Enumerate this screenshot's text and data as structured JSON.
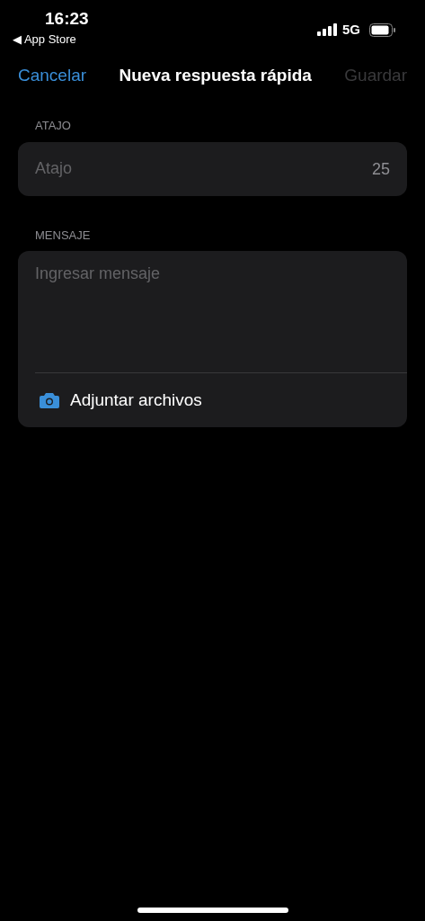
{
  "status_bar": {
    "time": "16:23",
    "back_label": "◀ App Store",
    "network": "5G"
  },
  "nav": {
    "cancel": "Cancelar",
    "title": "Nueva respuesta rápida",
    "save": {
      "label": "Guardar",
      "disabled": true
    }
  },
  "shortcut": {
    "section": "ATAJO",
    "placeholder": "Atajo",
    "counter": "25"
  },
  "message": {
    "section": "MENSAJE",
    "placeholder": "Ingresar mensaje",
    "attach": "Adjuntar archivos"
  }
}
